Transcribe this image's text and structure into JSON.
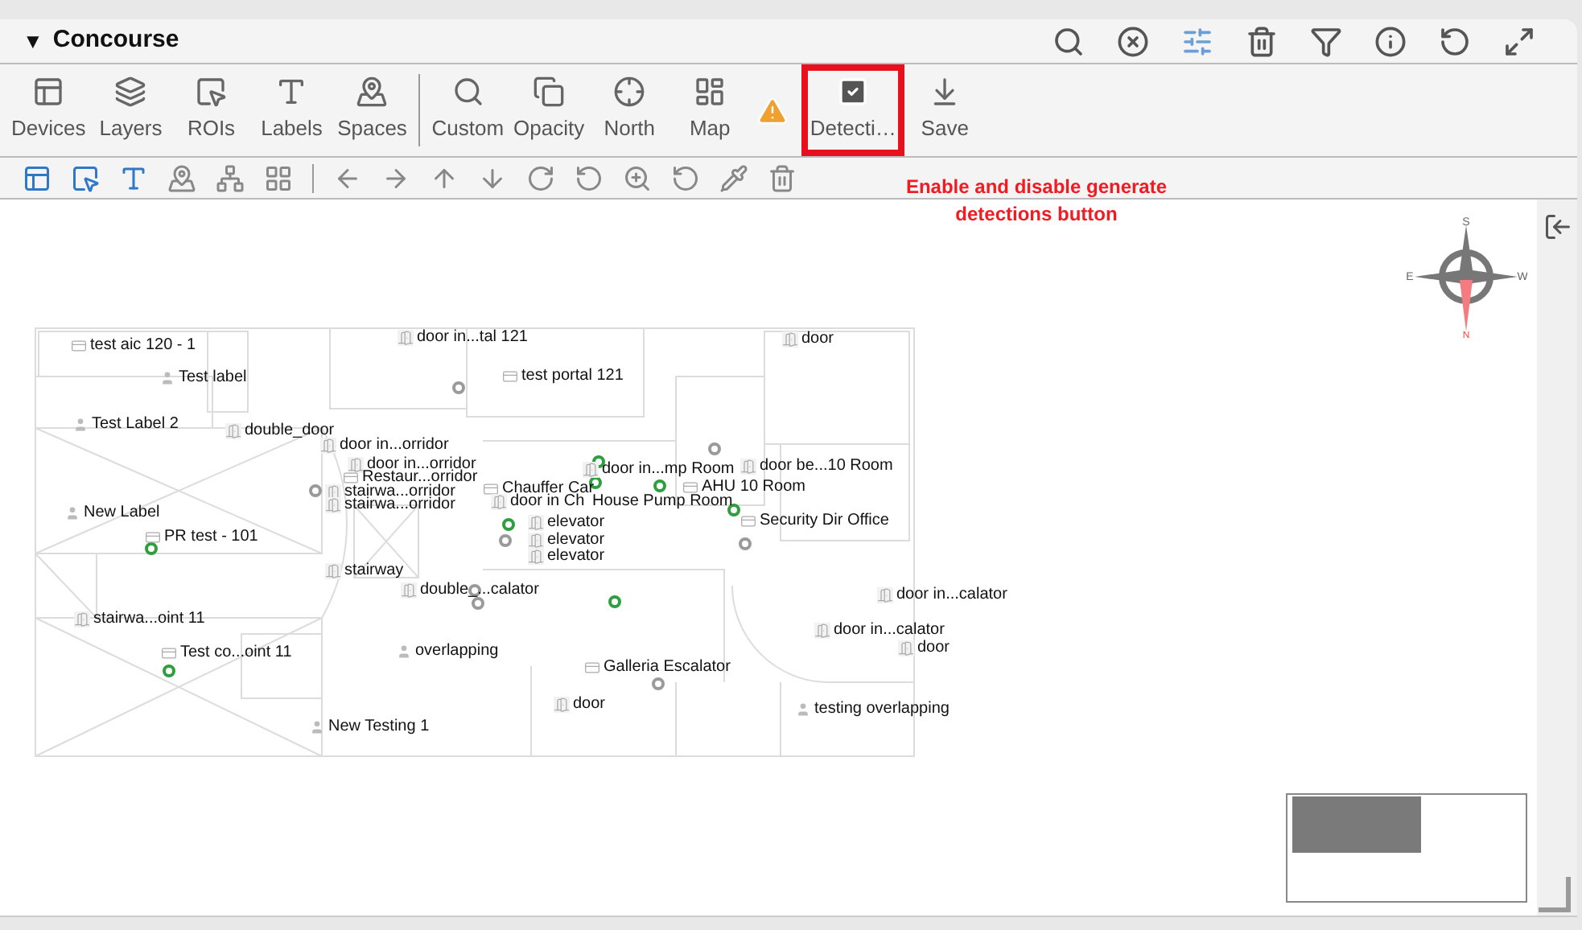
{
  "panel": {
    "title": "Concourse",
    "expanded": true,
    "toggle": "▼"
  },
  "header_tools": [
    {
      "kind": "search",
      "selected": false
    },
    {
      "kind": "clear",
      "selected": false
    },
    {
      "kind": "sliders",
      "selected": true
    },
    {
      "kind": "trash",
      "selected": false
    },
    {
      "kind": "filter",
      "selected": false
    },
    {
      "kind": "info",
      "selected": false
    },
    {
      "kind": "refresh",
      "selected": false
    },
    {
      "kind": "expand",
      "selected": false
    }
  ],
  "toolbar": [
    {
      "kind": "devices",
      "label": "Devices"
    },
    {
      "kind": "layers",
      "label": "Layers"
    },
    {
      "kind": "rois",
      "label": "ROIs"
    },
    {
      "kind": "labels",
      "label": "Labels"
    },
    {
      "kind": "spaces",
      "label": "Spaces"
    },
    {
      "kind": "divider"
    },
    {
      "kind": "custom",
      "label": "Custom"
    },
    {
      "kind": "opacity",
      "label": "Opacity"
    },
    {
      "kind": "north",
      "label": "North"
    },
    {
      "kind": "map",
      "label": "Map"
    },
    {
      "kind": "warning"
    },
    {
      "kind": "detections",
      "label": "Detecti…",
      "checked": true,
      "highlighted": true
    },
    {
      "kind": "save",
      "label": "Save"
    }
  ],
  "tools": [
    {
      "kind": "devices",
      "active": true
    },
    {
      "kind": "rois",
      "active": true
    },
    {
      "kind": "labels",
      "active": true
    },
    {
      "kind": "spaces",
      "active": false
    },
    {
      "kind": "tree",
      "active": false
    },
    {
      "kind": "grid",
      "active": false
    },
    {
      "kind": "divider"
    },
    {
      "kind": "left",
      "active": false
    },
    {
      "kind": "right",
      "active": false
    },
    {
      "kind": "up",
      "active": false
    },
    {
      "kind": "down",
      "active": false
    },
    {
      "kind": "rotate-right",
      "active": false
    },
    {
      "kind": "rotate-left",
      "active": false
    },
    {
      "kind": "zoom",
      "active": false
    },
    {
      "kind": "reset",
      "active": false
    },
    {
      "kind": "picker",
      "active": false
    },
    {
      "kind": "delete",
      "active": false
    }
  ],
  "annotation": {
    "text": "Enable and disable generate detections button"
  },
  "map_labels": [
    {
      "kind": "portal",
      "text": "test aic 120 - 1"
    },
    {
      "kind": "person",
      "text": "Test label"
    },
    {
      "kind": "person",
      "text": "Test Label 2"
    },
    {
      "kind": "door",
      "text": "double_door"
    },
    {
      "kind": "door",
      "text": "door in...orridor"
    },
    {
      "kind": "door",
      "text": "door in...orridor"
    },
    {
      "kind": "portal",
      "text": "Restaur...orridor"
    },
    {
      "kind": "door",
      "text": "stairwa...orridor"
    },
    {
      "kind": "door",
      "text": "stairwa...orridor"
    },
    {
      "kind": "person",
      "text": "New Label"
    },
    {
      "kind": "portal",
      "text": "PR test - 101"
    },
    {
      "kind": "door",
      "text": "stairway"
    },
    {
      "kind": "door",
      "text": "double_...calator"
    },
    {
      "kind": "door",
      "text": "stairwa...oint 11"
    },
    {
      "kind": "portal",
      "text": "Test co...oint 11"
    },
    {
      "kind": "person",
      "text": "overlapping"
    },
    {
      "kind": "person",
      "text": "New Testing 1"
    },
    {
      "kind": "door",
      "text": "door in...tal 121"
    },
    {
      "kind": "portal",
      "text": "test portal 121"
    },
    {
      "kind": "door",
      "text": "door"
    },
    {
      "kind": "door",
      "text": "door in...mp Room"
    },
    {
      "kind": "portal",
      "text": "Chauffer Car"
    },
    {
      "kind": "door",
      "text": "door in Ch"
    },
    {
      "kind": "none",
      "text": "House Pump Room"
    },
    {
      "kind": "portal",
      "text": "AHU 10 Room"
    },
    {
      "kind": "door",
      "text": "door be...10 Room"
    },
    {
      "kind": "door",
      "text": "elevator"
    },
    {
      "kind": "portal",
      "text": "Security Dir Office"
    },
    {
      "kind": "door",
      "text": "elevator"
    },
    {
      "kind": "door",
      "text": "elevator"
    },
    {
      "kind": "door",
      "text": "door in...calator"
    },
    {
      "kind": "door",
      "text": "door in...calator"
    },
    {
      "kind": "door",
      "text": "door"
    },
    {
      "kind": "portal",
      "text": "Galleria Escalator"
    },
    {
      "kind": "door",
      "text": "door"
    },
    {
      "kind": "person",
      "text": "testing overlapping"
    }
  ],
  "markers": [
    {
      "color": "#9a9a9a"
    },
    {
      "color": "#9a9a9a"
    },
    {
      "color": "#9a9a9a"
    },
    {
      "color": "#9a9a9a"
    },
    {
      "color": "#9a9a9a"
    },
    {
      "color": "#9a9a9a"
    },
    {
      "color": "#9a9a9a"
    },
    {
      "color": "#9a9a9a"
    },
    {
      "color": "#2e9e3e"
    },
    {
      "color": "#2e9e3e"
    },
    {
      "color": "#2e9e3e"
    },
    {
      "color": "#2e9e3e"
    },
    {
      "color": "#2e9e3e"
    },
    {
      "color": "#2e9e3e"
    },
    {
      "color": "#2e9e3e"
    },
    {
      "color": "#2e9e3e"
    }
  ],
  "compass": {
    "letters": [
      "S",
      "W",
      "N",
      "E"
    ]
  }
}
